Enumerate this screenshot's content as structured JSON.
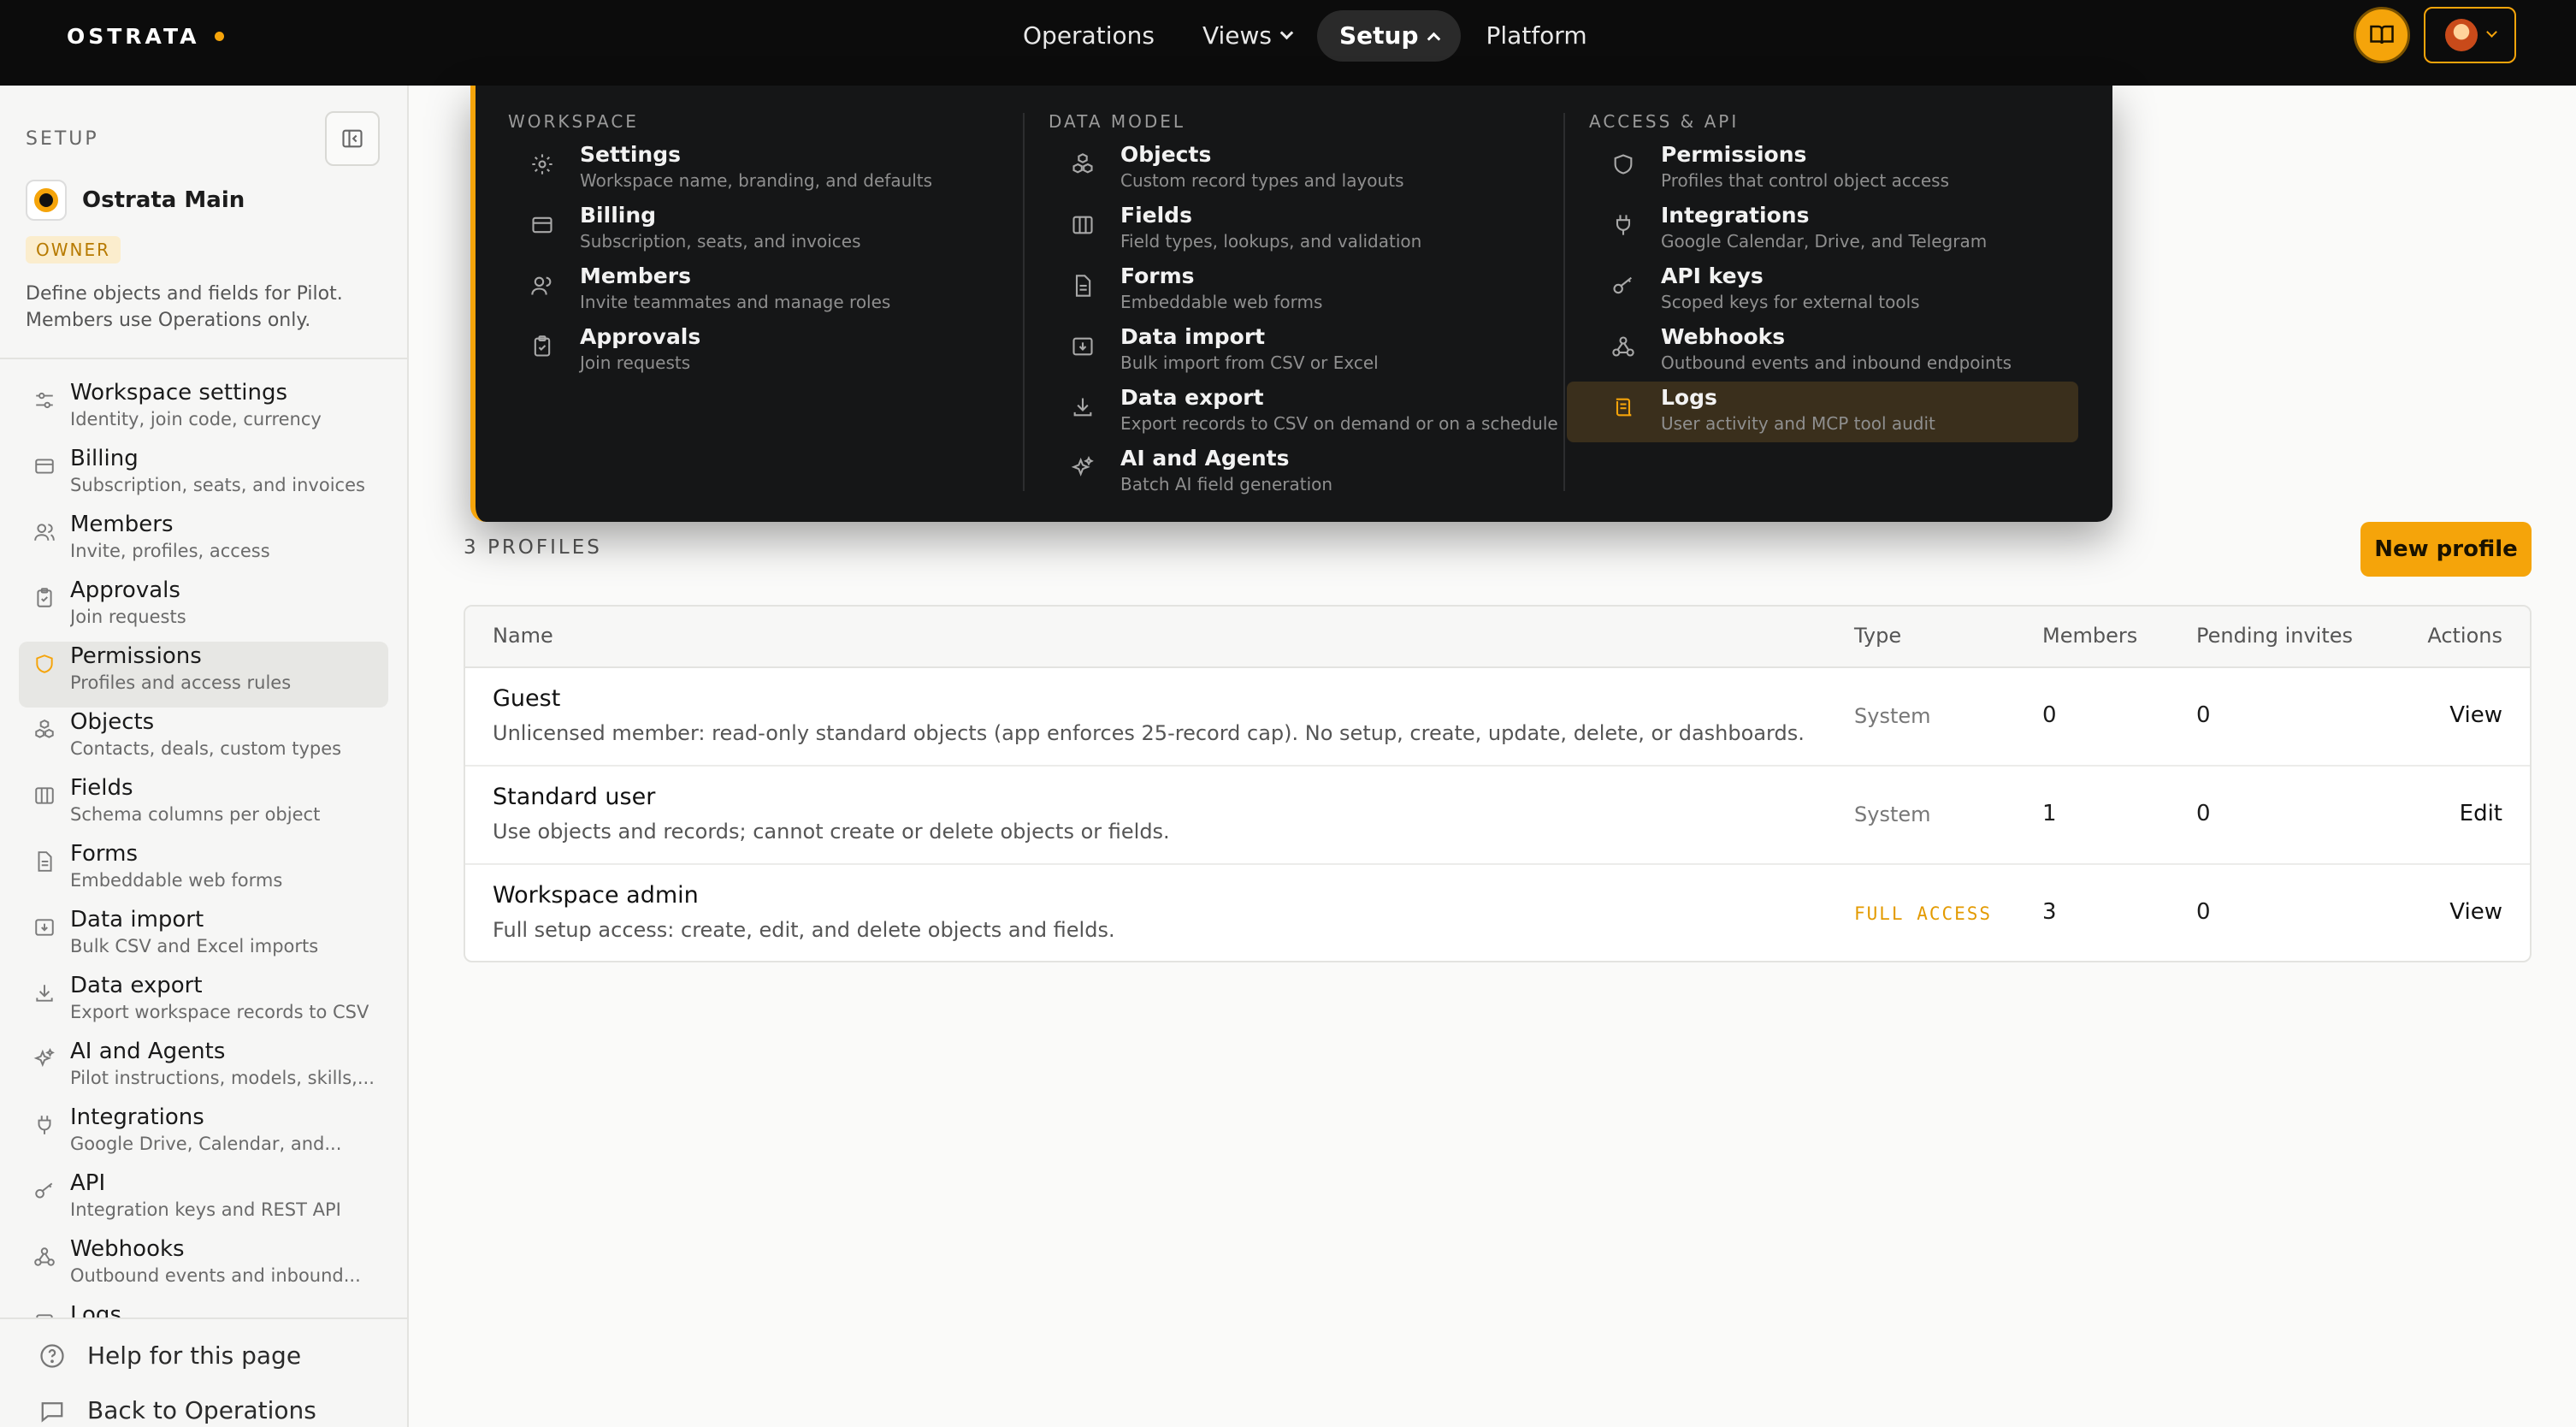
{
  "topbar": {
    "brand": "OSTRATA",
    "accent": "#f5a40a",
    "nav": [
      {
        "label": "Operations"
      },
      {
        "label": "Views"
      },
      {
        "label": "Setup"
      },
      {
        "label": "Platform"
      }
    ]
  },
  "sidebar": {
    "heading": "SETUP",
    "workspace_name": "Ostrata Main",
    "role_badge": "OWNER",
    "description": "Define objects and fields for Pilot. Members use Operations only.",
    "items": [
      {
        "title": "Workspace settings",
        "sub": "Identity, join code, currency",
        "icon": "sliders-icon"
      },
      {
        "title": "Billing",
        "sub": "Subscription, seats, and invoices",
        "icon": "credit-card-icon"
      },
      {
        "title": "Members",
        "sub": "Invite, profiles, access",
        "icon": "users-icon"
      },
      {
        "title": "Approvals",
        "sub": "Join requests",
        "icon": "clipboard-check-icon"
      },
      {
        "title": "Permissions",
        "sub": "Profiles and access rules",
        "icon": "shield-icon"
      },
      {
        "title": "Objects",
        "sub": "Contacts, deals, custom types",
        "icon": "cubes-icon"
      },
      {
        "title": "Fields",
        "sub": "Schema columns per object",
        "icon": "columns-icon"
      },
      {
        "title": "Forms",
        "sub": "Embeddable web forms",
        "icon": "document-icon"
      },
      {
        "title": "Data import",
        "sub": "Bulk CSV and Excel imports",
        "icon": "import-icon"
      },
      {
        "title": "Data export",
        "sub": "Export workspace records to CSV",
        "icon": "download-icon"
      },
      {
        "title": "AI and Agents",
        "sub": "Pilot instructions, models, skills,...",
        "icon": "sparkles-icon"
      },
      {
        "title": "Integrations",
        "sub": "Google Drive, Calendar, and...",
        "icon": "plug-icon"
      },
      {
        "title": "API",
        "sub": "Integration keys and REST API",
        "icon": "key-icon"
      },
      {
        "title": "Webhooks",
        "sub": "Outbound events and inbound...",
        "icon": "webhook-icon"
      },
      {
        "title": "Logs",
        "sub": "",
        "icon": "scroll-icon"
      }
    ],
    "footer": {
      "help": "Help for this page",
      "back": "Back to Operations"
    }
  },
  "mega_menu": {
    "columns": [
      {
        "heading": "WORKSPACE",
        "items": [
          {
            "title": "Settings",
            "sub": "Workspace name, branding, and defaults"
          },
          {
            "title": "Billing",
            "sub": "Subscription, seats, and invoices"
          },
          {
            "title": "Members",
            "sub": "Invite teammates and manage roles"
          },
          {
            "title": "Approvals",
            "sub": "Join requests"
          }
        ]
      },
      {
        "heading": "DATA MODEL",
        "items": [
          {
            "title": "Objects",
            "sub": "Custom record types and layouts"
          },
          {
            "title": "Fields",
            "sub": "Field types, lookups, and validation"
          },
          {
            "title": "Forms",
            "sub": "Embeddable web forms"
          },
          {
            "title": "Data import",
            "sub": "Bulk import from CSV or Excel"
          },
          {
            "title": "Data export",
            "sub": "Export records to CSV on demand or on a schedule"
          },
          {
            "title": "AI and Agents",
            "sub": "Batch AI field generation"
          }
        ]
      },
      {
        "heading": "ACCESS & API",
        "items": [
          {
            "title": "Permissions",
            "sub": "Profiles that control object access"
          },
          {
            "title": "Integrations",
            "sub": "Google Calendar, Drive, and Telegram"
          },
          {
            "title": "API keys",
            "sub": "Scoped keys for external tools"
          },
          {
            "title": "Webhooks",
            "sub": "Outbound events and inbound endpoints"
          },
          {
            "title": "Logs",
            "sub": "User activity and MCP tool audit"
          }
        ]
      }
    ]
  },
  "main": {
    "profiles_label": "3 PROFILES",
    "new_profile_label": "New profile",
    "columns": {
      "name": "Name",
      "type": "Type",
      "members": "Members",
      "pending": "Pending invites",
      "actions": "Actions"
    },
    "rows": [
      {
        "name": "Guest",
        "desc": "Unlicensed member: read-only standard objects (app enforces 25-record cap). No setup, create, update, delete, or dashboards.",
        "type": "System",
        "members": "0",
        "pending": "0",
        "action": "View"
      },
      {
        "name": "Standard user",
        "desc": "Use objects and records; cannot create or delete objects or fields.",
        "type": "System",
        "members": "1",
        "pending": "0",
        "action": "Edit"
      },
      {
        "name": "Workspace admin",
        "desc": "Full setup access: create, edit, and delete objects and fields.",
        "type": "FULL ACCESS",
        "members": "3",
        "pending": "0",
        "action": "View"
      }
    ]
  }
}
